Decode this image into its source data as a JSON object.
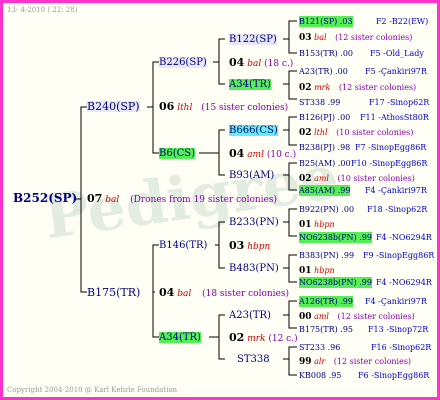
{
  "header": {
    "date": "13-  4-2010  ( 22: 28)"
  },
  "footer": {
    "copyright": "Copyright 2004-2010 @ Karl Kehrle Foundation"
  },
  "watermark": {
    "text": "Pedigree"
  },
  "colors": {
    "frame": "#ff33cc",
    "name_text": "#000080",
    "queen_text": "#cc0000",
    "sister_text": "#8800aa",
    "location_text": "#0000cc",
    "highlight_green": "#55ee55",
    "highlight_cyan": "#66eeee"
  },
  "tree": {
    "root": {
      "name": "B252(SP)",
      "year": "07",
      "queen": "bal",
      "note": "(Drones from 19 sister colonies)"
    },
    "sire": {
      "name": "B240(SP)",
      "year": "06",
      "queen": "lthl",
      "note": "(15 sister colonies)"
    },
    "dam": {
      "name": "B175(TR)",
      "year": "04",
      "queen": "bal",
      "note": "(18 sister colonies)"
    },
    "sire_sire": {
      "name": "B226(SP)",
      "year": "04",
      "queen": "bal",
      "note": "(18 c.)"
    },
    "sire_dam": {
      "name": "B6(CS)"
    },
    "dam_sire": {
      "name": "B146(TR)",
      "year": "03",
      "queen": "hbpn"
    },
    "dam_dam": {
      "name": "A34(TR)",
      "year": "02",
      "queen": "mrk",
      "note": "(12 c.)"
    },
    "ss_sire": {
      "name": "B122(SP)"
    },
    "ss_dam": {
      "name": "A34(TR)"
    },
    "sd_sire": {
      "name": "B666(CS)",
      "year": "04",
      "queen": "aml",
      "note": "(10 c.)"
    },
    "sd_dam": {
      "name": "B93(AM)"
    },
    "ds_sire": {
      "name": "B233(PN)"
    },
    "ds_dam": {
      "name": "B483(PN)"
    },
    "dd_sire": {
      "name": "A23(TR)"
    },
    "dd_dam": {
      "name": "ST338"
    }
  },
  "leaves": [
    {
      "name": "B121(SP) .03",
      "info": "F2 -B22(EW)"
    },
    {
      "year": "03",
      "queen": "bal",
      "info": "(12 sister colonies)"
    },
    {
      "name": "B153(TR) .00",
      "info": "F5 -Old_Lady"
    },
    {
      "name": "A23(TR) .00",
      "info": "F5 -Çankiri97R"
    },
    {
      "year": "02",
      "queen": "mrk",
      "info": "(12 sister colonies)"
    },
    {
      "name": "ST338 .99",
      "info": "F17 -Sinop62R"
    },
    {
      "name": "B126(PJ) .00",
      "info": "F11 -AthosSt80R"
    },
    {
      "year": "02",
      "queen": "lthl",
      "info": "(10 sister colonies)"
    },
    {
      "name": "B238(PJ) .98",
      "info": "F7 -SinopEgg86R"
    },
    {
      "name": "B25(AM) .00",
      "info": "F10 -SinopEgg86R"
    },
    {
      "year": "02",
      "queen": "aml",
      "info": "(10 sister colonies)"
    },
    {
      "name": "A85(AM) .99",
      "info": "F4 -Çankiri97R"
    },
    {
      "name": "B922(PN) .00",
      "info": "F18 -Sinop62R"
    },
    {
      "year": "01",
      "queen": "hbpn",
      "info": ""
    },
    {
      "name": "NO6238b(PN) .99",
      "info": "F4 -NO6294R"
    },
    {
      "name": "B383(PN) .99",
      "info": "F9 -SinopEgg86R"
    },
    {
      "year": "01",
      "queen": "hbpn",
      "info": ""
    },
    {
      "name": "NO6238b(PN) .99",
      "info": "F4 -NO6294R"
    },
    {
      "name": "A126(TR) .99",
      "info": "F4 -Çankiri97R"
    },
    {
      "year": "00",
      "queen": "aml",
      "info": "(12 sister colonies)"
    },
    {
      "name": "B175(TR) .95",
      "info": "F13 -Sinop72R"
    },
    {
      "name": "ST233 .96",
      "info": "F16 -Sinop62R"
    },
    {
      "year": "99",
      "queen": "alr",
      "info": "(12 sister colonies)"
    },
    {
      "name": "KB008 .95",
      "info": "F6 -SinopEgg86R"
    }
  ]
}
